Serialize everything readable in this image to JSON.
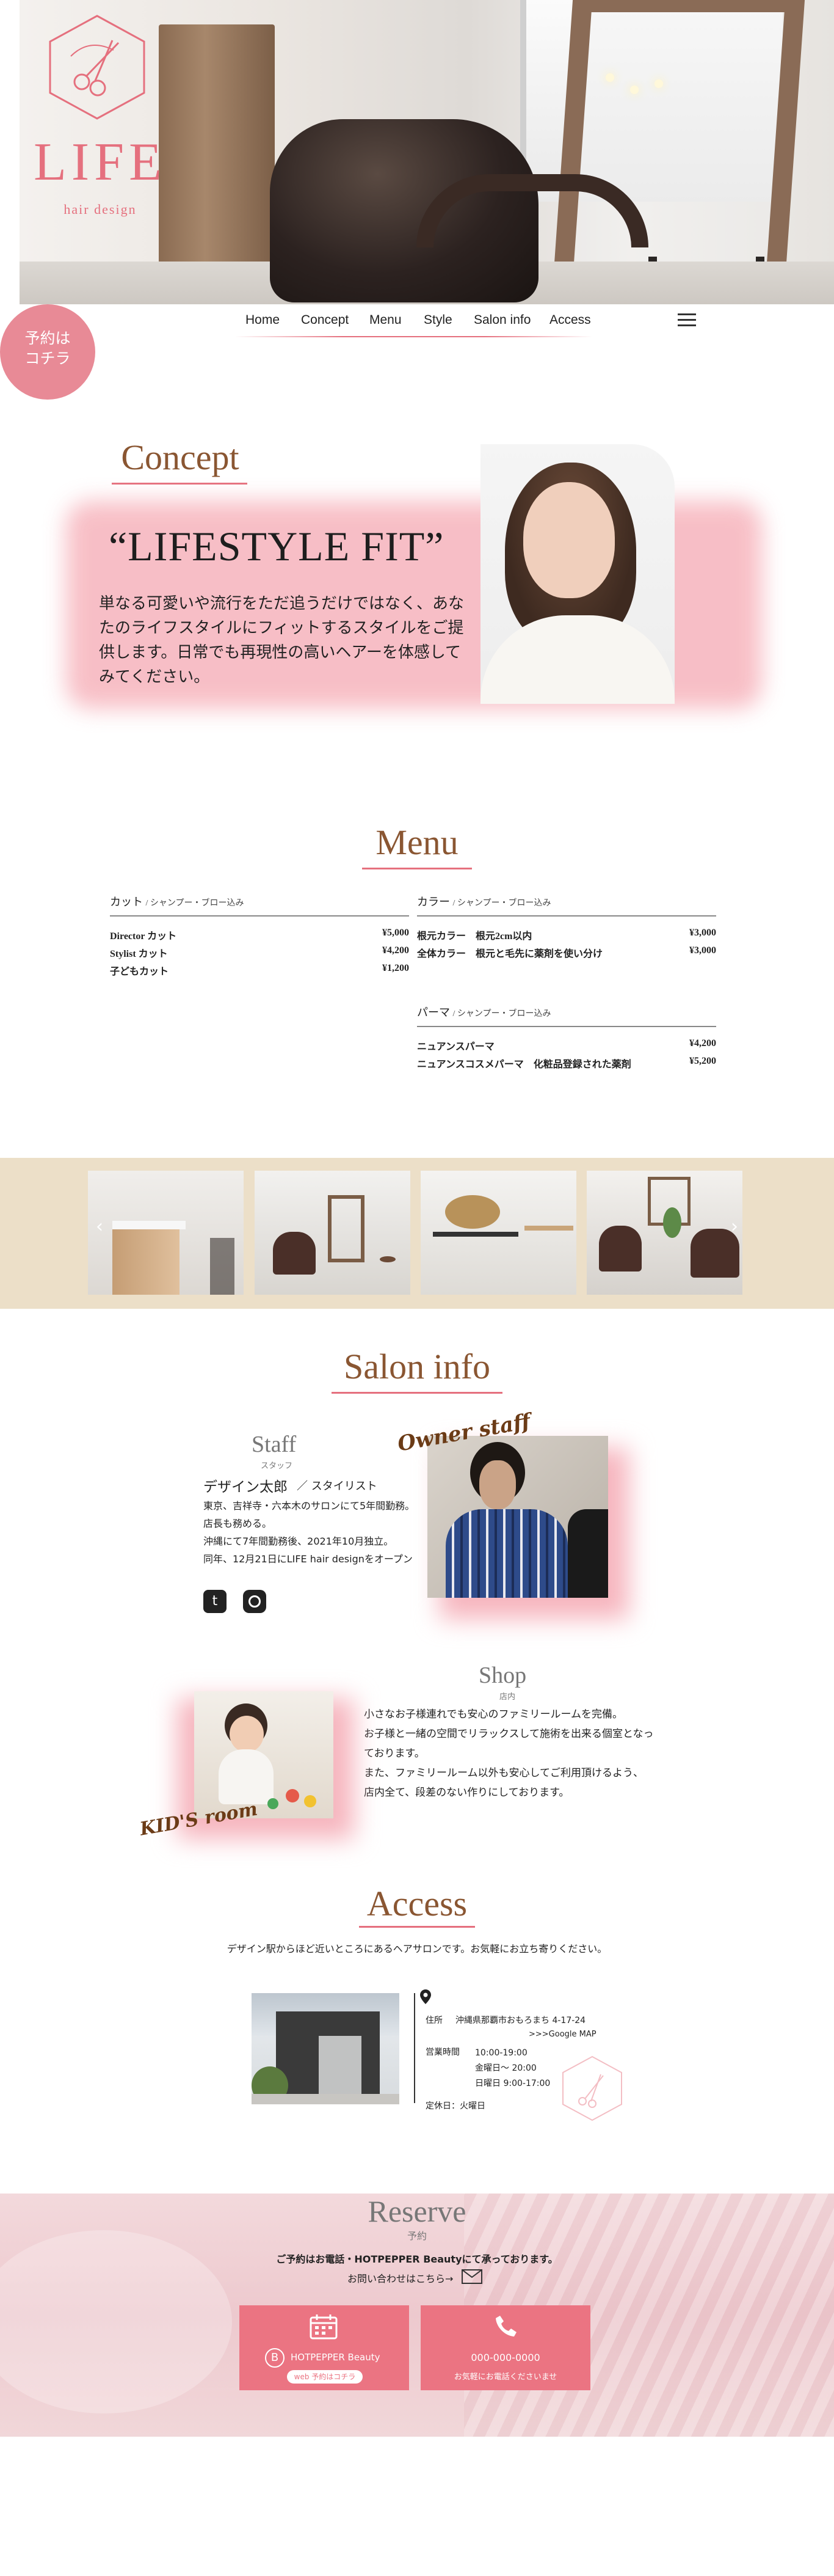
{
  "brand": {
    "name": "LIFE",
    "tagline": "hair design",
    "accent": "#e5707e",
    "title_color": "#8a5632"
  },
  "nav": {
    "items": [
      "Home",
      "Concept",
      "Menu",
      "Style",
      "Salon info",
      "Access"
    ],
    "reserve_badge": [
      "予約は",
      "コチラ"
    ]
  },
  "concept": {
    "title": "Concept",
    "quote": "“LIFESTYLE FIT”",
    "text": "単なる可愛いや流行をただ追うだけではなく、あなたのライフスタイルにフィットするスタイルをご提供します。日常でも再現性の高いヘアーを体感してみてください。"
  },
  "menu": {
    "title": "Menu",
    "columns": [
      {
        "name": "カット",
        "note": "/ シャンプー・ブロー込み",
        "items": [
          {
            "name": "Director カット",
            "price": "¥5,000"
          },
          {
            "name": "Stylist カット",
            "price": "¥4,200"
          },
          {
            "name": "子どもカット",
            "price": "¥1,200"
          }
        ]
      },
      {
        "name": "カラー",
        "note": "/ シャンプー・ブロー込み",
        "items": [
          {
            "name": "根元カラー　根元2cm以内",
            "price": "¥3,000"
          },
          {
            "name": "全体カラー　根元と毛先に薬剤を使い分け",
            "price": "¥3,000"
          }
        ]
      },
      {
        "name": "パーマ",
        "note": "/ シャンプー・ブロー込み",
        "items": [
          {
            "name": "ニュアンスパーマ",
            "price": "¥4,200"
          },
          {
            "name": "ニュアンスコスメパーマ　化粧品登録された薬剤",
            "price": "¥5,200"
          }
        ]
      }
    ]
  },
  "gallery": {
    "prev_icon": "chevron-left-icon",
    "next_icon": "chevron-right-icon",
    "background": "#ecdfc8"
  },
  "salon": {
    "title": "Salon info",
    "staff": {
      "heading": "Staff",
      "heading_sub": "スタッフ",
      "script_label": "Owner staff",
      "name": "デザイン太郎",
      "role": "／ スタイリスト",
      "bio": [
        "東京、吉祥寺・六本木のサロンにて5年間勤務。",
        "店長も務める。",
        "沖縄にて7年間勤務後、2021年10月独立。",
        "同年、12月21日にLIFE hair designをオープン"
      ],
      "social": [
        "twitter-icon",
        "instagram-icon"
      ]
    },
    "shop": {
      "heading": "Shop",
      "heading_sub": "店内",
      "script_label": "KID'S room",
      "text": [
        "小さなお子様連れでも安心のファミリールームを完備。",
        "お子様と一緒の空間でリラックスして施術を出来る個室となっております。",
        "また、ファミリールーム以外も安心してご利用頂けるよう、",
        "店内全て、段差のない作りにしております。"
      ]
    }
  },
  "access": {
    "title": "Access",
    "lead": "デザイン駅からほど近いところにあるヘアサロンです。お気軽にお立ち寄りください。",
    "address_label": "住所",
    "address": "沖縄県那覇市おもろまち 4-17-24",
    "map_link": ">>>Google MAP",
    "hours_label": "営業時間",
    "hours": [
      "10:00-19:00",
      "金曜日〜 20:00",
      "日曜日 9:00-17:00"
    ],
    "closed": "定休日：火曜日"
  },
  "reserve": {
    "title": "Reserve",
    "title_sub": "予約",
    "lead": "ご予約はお電話・HOTPEPPER Beautyにて承っております。",
    "contact": "お問い合わせはこちら→",
    "hotpepper": {
      "label": "HOTPEPPER Beauty",
      "button": "web 予約はコチラ"
    },
    "phone": {
      "number": "000-000-0000",
      "note": "お気軽にお電話くださいませ"
    }
  }
}
